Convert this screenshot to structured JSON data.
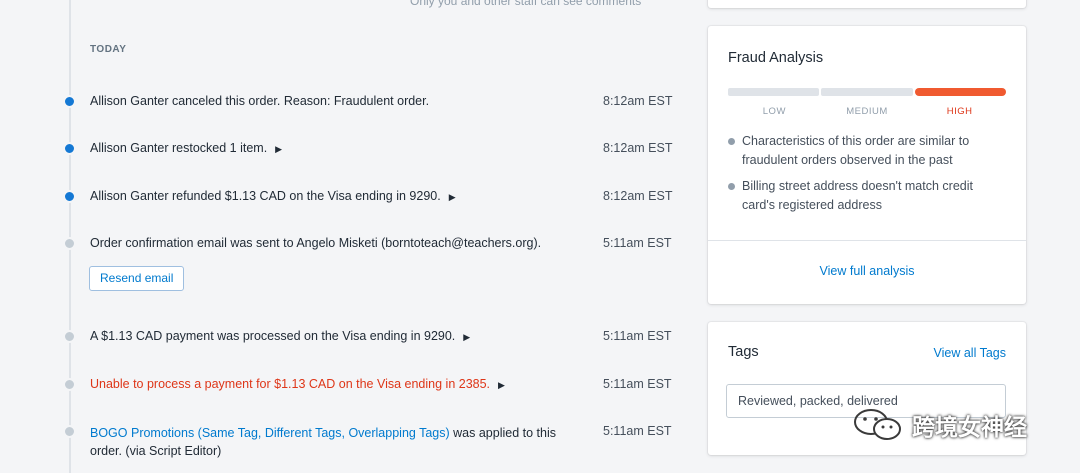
{
  "timeline": {
    "top_note": "Only you and other staff can see comments",
    "day_label": "TODAY",
    "events": [
      {
        "text": "Allison Ganter canceled this order. Reason: Fraudulent order.",
        "time": "8:12am EST"
      },
      {
        "text": "Allison Ganter restocked 1 item.",
        "time": "8:12am EST",
        "caret": "▶"
      },
      {
        "text": "Allison Ganter refunded $1.13 CAD on the Visa ending in 9290.",
        "time": "8:12am EST",
        "caret": "▶"
      },
      {
        "text": "Order confirmation email was sent to Angelo Misketi (borntoteach@teachers.org).",
        "time": "5:11am EST"
      },
      {
        "text": "A $1.13 CAD payment was processed on the Visa ending in 9290.",
        "time": "5:11am EST",
        "caret": "▶"
      },
      {
        "text": "Unable to process a payment for $1.13 CAD on the Visa ending in 2385.",
        "time": "5:11am EST",
        "caret": "▶"
      },
      {
        "link_text": "BOGO Promotions (Same Tag, Different Tags, Overlapping Tags)",
        "text_after": " was applied to this order. (via Script Editor)",
        "time": "5:11am EST"
      }
    ],
    "resend_label": "Resend email"
  },
  "fraud": {
    "title": "Fraud Analysis",
    "levels": [
      "LOW",
      "MEDIUM",
      "HIGH"
    ],
    "active_level": "HIGH",
    "findings": [
      "Characteristics of this order are similar to fraudulent orders observed in the past",
      "Billing street address doesn't match credit card's registered address"
    ],
    "full_analysis_link": "View full analysis"
  },
  "tags": {
    "title": "Tags",
    "view_all": "View all Tags",
    "value": "Reviewed, packed, delivered"
  },
  "watermark": {
    "text": "跨境女神经",
    "icon": "wechat-logo-icon"
  },
  "colors": {
    "background": "#f4f5f7",
    "timeline_dot_active": "#1478d4",
    "timeline_dot_inactive": "#c4cdd5",
    "link": "#007ace",
    "error_text": "#de3618",
    "risk_high": "#f05a30"
  }
}
